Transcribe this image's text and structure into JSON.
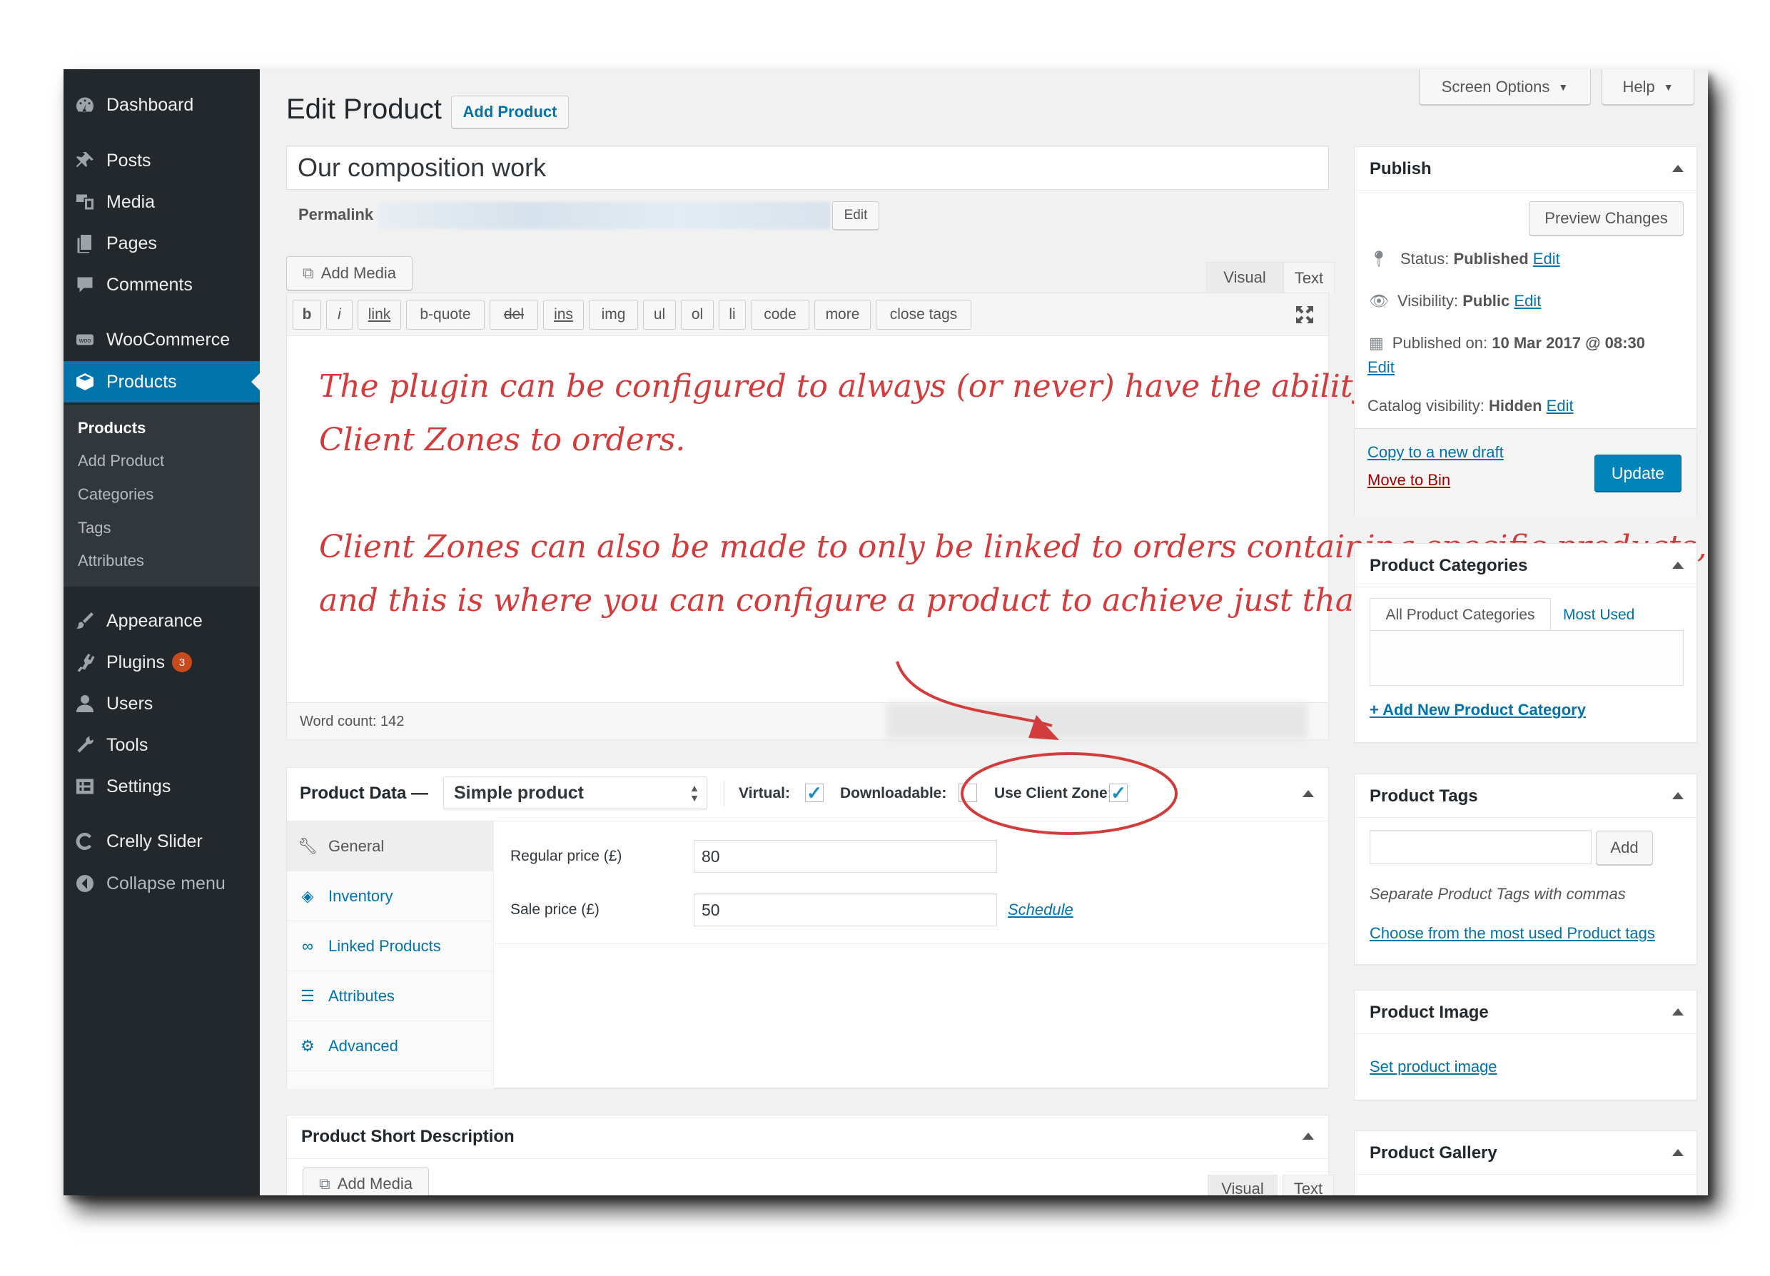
{
  "sidebar": {
    "items": [
      {
        "label": "Dashboard",
        "icon": "dashboard-icon"
      },
      {
        "label": "Posts",
        "icon": "pin-icon"
      },
      {
        "label": "Media",
        "icon": "media-icon"
      },
      {
        "label": "Pages",
        "icon": "pages-icon"
      },
      {
        "label": "Comments",
        "icon": "comments-icon"
      },
      {
        "label": "WooCommerce",
        "icon": "woo-icon"
      },
      {
        "label": "Products",
        "icon": "products-icon"
      },
      {
        "label": "Appearance",
        "icon": "appearance-icon"
      },
      {
        "label": "Plugins",
        "icon": "plugins-icon",
        "badge": "3"
      },
      {
        "label": "Users",
        "icon": "users-icon"
      },
      {
        "label": "Tools",
        "icon": "tools-icon"
      },
      {
        "label": "Settings",
        "icon": "settings-icon"
      },
      {
        "label": "Crelly Slider",
        "icon": "crelly-icon"
      },
      {
        "label": "Collapse menu",
        "icon": "collapse-icon"
      }
    ],
    "submenu": [
      "Products",
      "Add Product",
      "Categories",
      "Tags",
      "Attributes"
    ]
  },
  "topbar": {
    "screen_options": "Screen Options",
    "help": "Help"
  },
  "page": {
    "title": "Edit Product",
    "add_button": "Add Product"
  },
  "editor": {
    "post_title": "Our composition work",
    "permalink_label": "Permalink",
    "permalink_edit": "Edit",
    "add_media": "Add Media",
    "tab_visual": "Visual",
    "tab_text": "Text",
    "quicktags": [
      "b",
      "i",
      "link",
      "b-quote",
      "del",
      "ins",
      "img",
      "ul",
      "ol",
      "li",
      "code",
      "more",
      "close tags"
    ],
    "annotation_lines": [
      "The plugin can be configured to always (or never) have the ability to link",
      "Client Zones to orders.",
      "Client Zones can also be made to only be linked to orders containing specific products,",
      "and this is where you can configure a product to achieve just that"
    ],
    "word_count": "Word count: 142"
  },
  "product_data": {
    "label": "Product Data —",
    "type_select": "Simple product",
    "virtual_label": "Virtual:",
    "virtual_checked": true,
    "downloadable_label": "Downloadable:",
    "downloadable_checked": false,
    "client_zone_label": "Use Client Zone:",
    "client_zone_checked": true,
    "tabs": [
      {
        "label": "General",
        "icon": "wrench-icon"
      },
      {
        "label": "Inventory",
        "icon": "tag-icon"
      },
      {
        "label": "Linked Products",
        "icon": "link-icon"
      },
      {
        "label": "Attributes",
        "icon": "list-icon"
      },
      {
        "label": "Advanced",
        "icon": "gear-icon"
      }
    ],
    "regular_price_label": "Regular price (£)",
    "regular_price": "80",
    "sale_price_label": "Sale price (£)",
    "sale_price": "50",
    "schedule_link": "Schedule"
  },
  "short_description": {
    "title": "Product Short Description",
    "add_media": "Add Media",
    "tab_visual": "Visual",
    "tab_text": "Text"
  },
  "publish": {
    "title": "Publish",
    "preview": "Preview Changes",
    "status_label": "Status:",
    "status_value": "Published",
    "visibility_label": "Visibility:",
    "visibility_value": "Public",
    "published_label": "Published on:",
    "published_value": "10 Mar 2017 @ 08:30",
    "catalog_label": "Catalog visibility:",
    "catalog_value": "Hidden",
    "edit": "Edit",
    "copy_draft": "Copy to a new draft",
    "move_bin": "Move to Bin",
    "update": "Update"
  },
  "categories": {
    "title": "Product Categories",
    "tab_all": "All Product Categories",
    "tab_most": "Most Used",
    "add_new": "+ Add New Product Category"
  },
  "tags": {
    "title": "Product Tags",
    "add": "Add",
    "hint": "Separate Product Tags with commas",
    "choose": "Choose from the most used Product tags"
  },
  "image": {
    "title": "Product Image",
    "set": "Set product image"
  },
  "gallery": {
    "title": "Product Gallery"
  },
  "colors": {
    "accent": "#0073aa",
    "sidebar": "#23282d",
    "annotation": "#d23c3c",
    "danger": "#a00000"
  }
}
